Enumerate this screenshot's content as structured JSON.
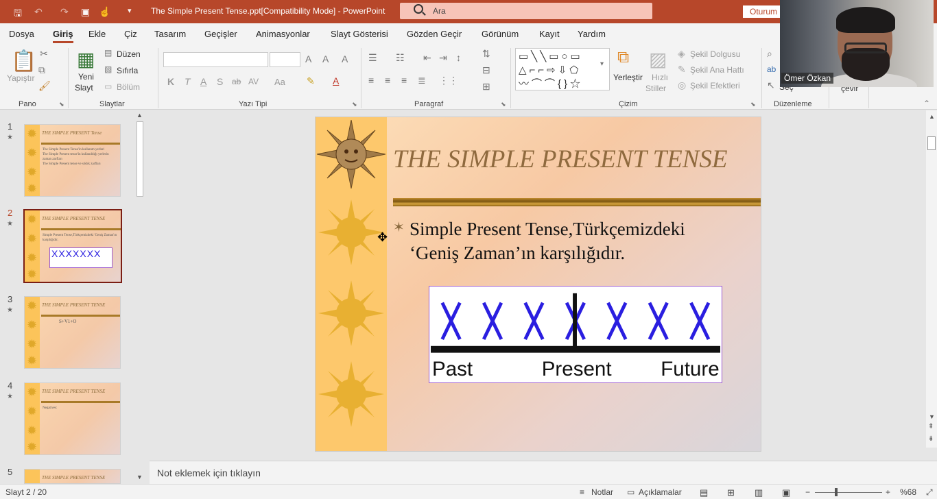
{
  "titlebar": {
    "doc_title": "The Simple Present Tense.ppt[Compatibility Mode]  -  PowerPoint",
    "search_placeholder": "Ara",
    "signin_label": "Oturum",
    "color": "#b7472a"
  },
  "menu": [
    "Dosya",
    "Giriş",
    "Ekle",
    "Çiz",
    "Tasarım",
    "Geçişler",
    "Animasyonlar",
    "Slayt Gösterisi",
    "Gözden Geçir",
    "Görünüm",
    "Kayıt",
    "Yardım"
  ],
  "menu_active": "Giriş",
  "ribbon": {
    "pano": {
      "paste": "Yapıştır",
      "label": "Pano"
    },
    "slaytlar": {
      "new_slide_1": "Yeni",
      "new_slide_2": "Slayt",
      "layout": "Düzen",
      "reset": "Sıfırla",
      "section": "Bölüm",
      "label": "Slaytlar"
    },
    "yazi": {
      "label": "Yazı Tipi",
      "bold": "K",
      "italic": "T",
      "underline": "A",
      "shadow": "S",
      "strike": "ab",
      "spacing": "AV",
      "case": "Aa"
    },
    "paragraf": {
      "label": "Paragraf"
    },
    "cizim": {
      "arrange": "Yerleştir",
      "quick_1": "Hızlı",
      "quick_2": "Stiller",
      "fill": "Şekil Dolgusu",
      "outline": "Şekil Ana Hattı",
      "effects": "Şekil Efektleri",
      "label": "Çizim"
    },
    "duzenleme": {
      "select": "Seç",
      "label": "Düzenleme",
      "cevir": "çevir"
    }
  },
  "thumbnails": [
    {
      "num": "1",
      "title": "THE SIMPLE PRESENT Tense",
      "lines": [
        "The Simple Present Tense'in kullanım yerleri",
        "The Simple Present tense'in kullanıldığı yerlerin zaman zarfları",
        "The Simple Present tense ve sıklık zarfları"
      ]
    },
    {
      "num": "2",
      "title": "THE SIMPLE PRESENT TENSE",
      "lines": [
        "Simple Present Tense,Türkçemizdeki 'Geniş Zaman'ın karşılığıdır."
      ]
    },
    {
      "num": "3",
      "title": "THE SIMPLE PRESENT TENSE",
      "lines": [
        "S+V1+O"
      ]
    },
    {
      "num": "4",
      "title": "THE SIMPLE PRESENT TENSE",
      "lines": [
        "Negatives:"
      ]
    },
    {
      "num": "5",
      "title": "THE SIMPLE PRESENT TENSE",
      "lines": []
    }
  ],
  "slide": {
    "title": "THE SIMPLE PRESENT TENSE",
    "body": "Simple Present Tense,Türkçemizdeki ‘Geniş Zaman’ın karşılığıdır.",
    "timeline": {
      "marks": "X",
      "count": 7,
      "labels": [
        "Past",
        "Present",
        "Future"
      ],
      "mark_color": "#2a1ee0"
    }
  },
  "notes_placeholder": "Not eklemek için tıklayın",
  "status": {
    "slide": "Slayt 2 / 20",
    "notes": "Notlar",
    "comments": "Açıklamalar",
    "zoom": "%68"
  },
  "webcam": {
    "name": "Ömer Özkan"
  }
}
